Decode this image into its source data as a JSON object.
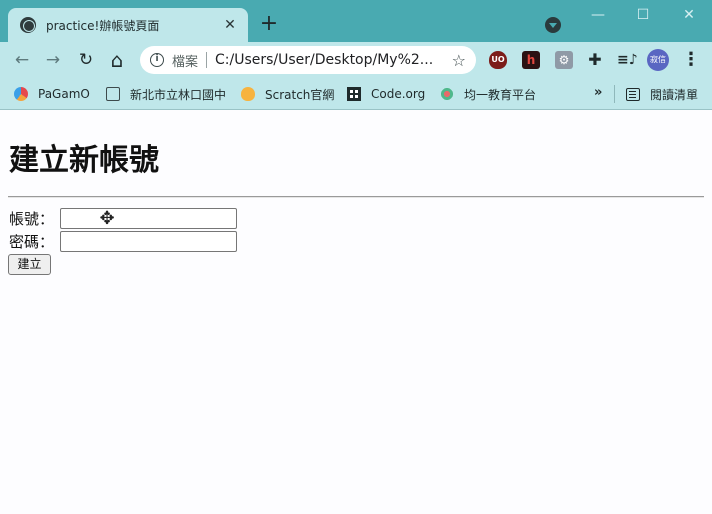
{
  "browser": {
    "tab": {
      "title": "practice!辦帳號頁面",
      "close": "✕"
    },
    "new_tab": "+",
    "window_controls": {
      "minimize": "—",
      "maximize": "☐",
      "close": "✕"
    },
    "toolbar": {
      "back": "←",
      "forward": "→",
      "reload": "↻",
      "home": "⌂",
      "omnibox": {
        "label": "檔案",
        "url": "C:/Users/User/Desktop/My%2...",
        "star": "☆"
      },
      "extensions": [
        {
          "name": "ublock-icon",
          "glyph": "UO"
        },
        {
          "name": "red-extension-icon",
          "glyph": "h"
        },
        {
          "name": "gear-extension-icon",
          "glyph": "⚙"
        },
        {
          "name": "puzzle-icon",
          "glyph": "✚"
        },
        {
          "name": "media-control-icon",
          "glyph": "≡♪"
        }
      ],
      "avatar": "寂信",
      "menu": "⋮"
    },
    "bookmarks": [
      {
        "label": "PaGamO",
        "icon": "pagamo-icon"
      },
      {
        "label": "新北市立林口國中",
        "icon": "document-icon"
      },
      {
        "label": "Scratch官網",
        "icon": "scratch-icon"
      },
      {
        "label": "Code.org",
        "icon": "code-org-icon"
      },
      {
        "label": "均一教育平台",
        "icon": "junyi-icon"
      }
    ],
    "bookmarks_more": "»",
    "reading_list": "閱讀清單"
  },
  "page": {
    "title": "建立新帳號",
    "form": {
      "account_label": "帳號：",
      "account_value": "",
      "password_label": "密碼：",
      "password_value": "",
      "submit_label": "建立"
    },
    "cursor": "✥"
  },
  "colors": {
    "titlebar": "#49aab1",
    "toolbar": "#bfe7ea",
    "page_background": "#fdfdff"
  }
}
